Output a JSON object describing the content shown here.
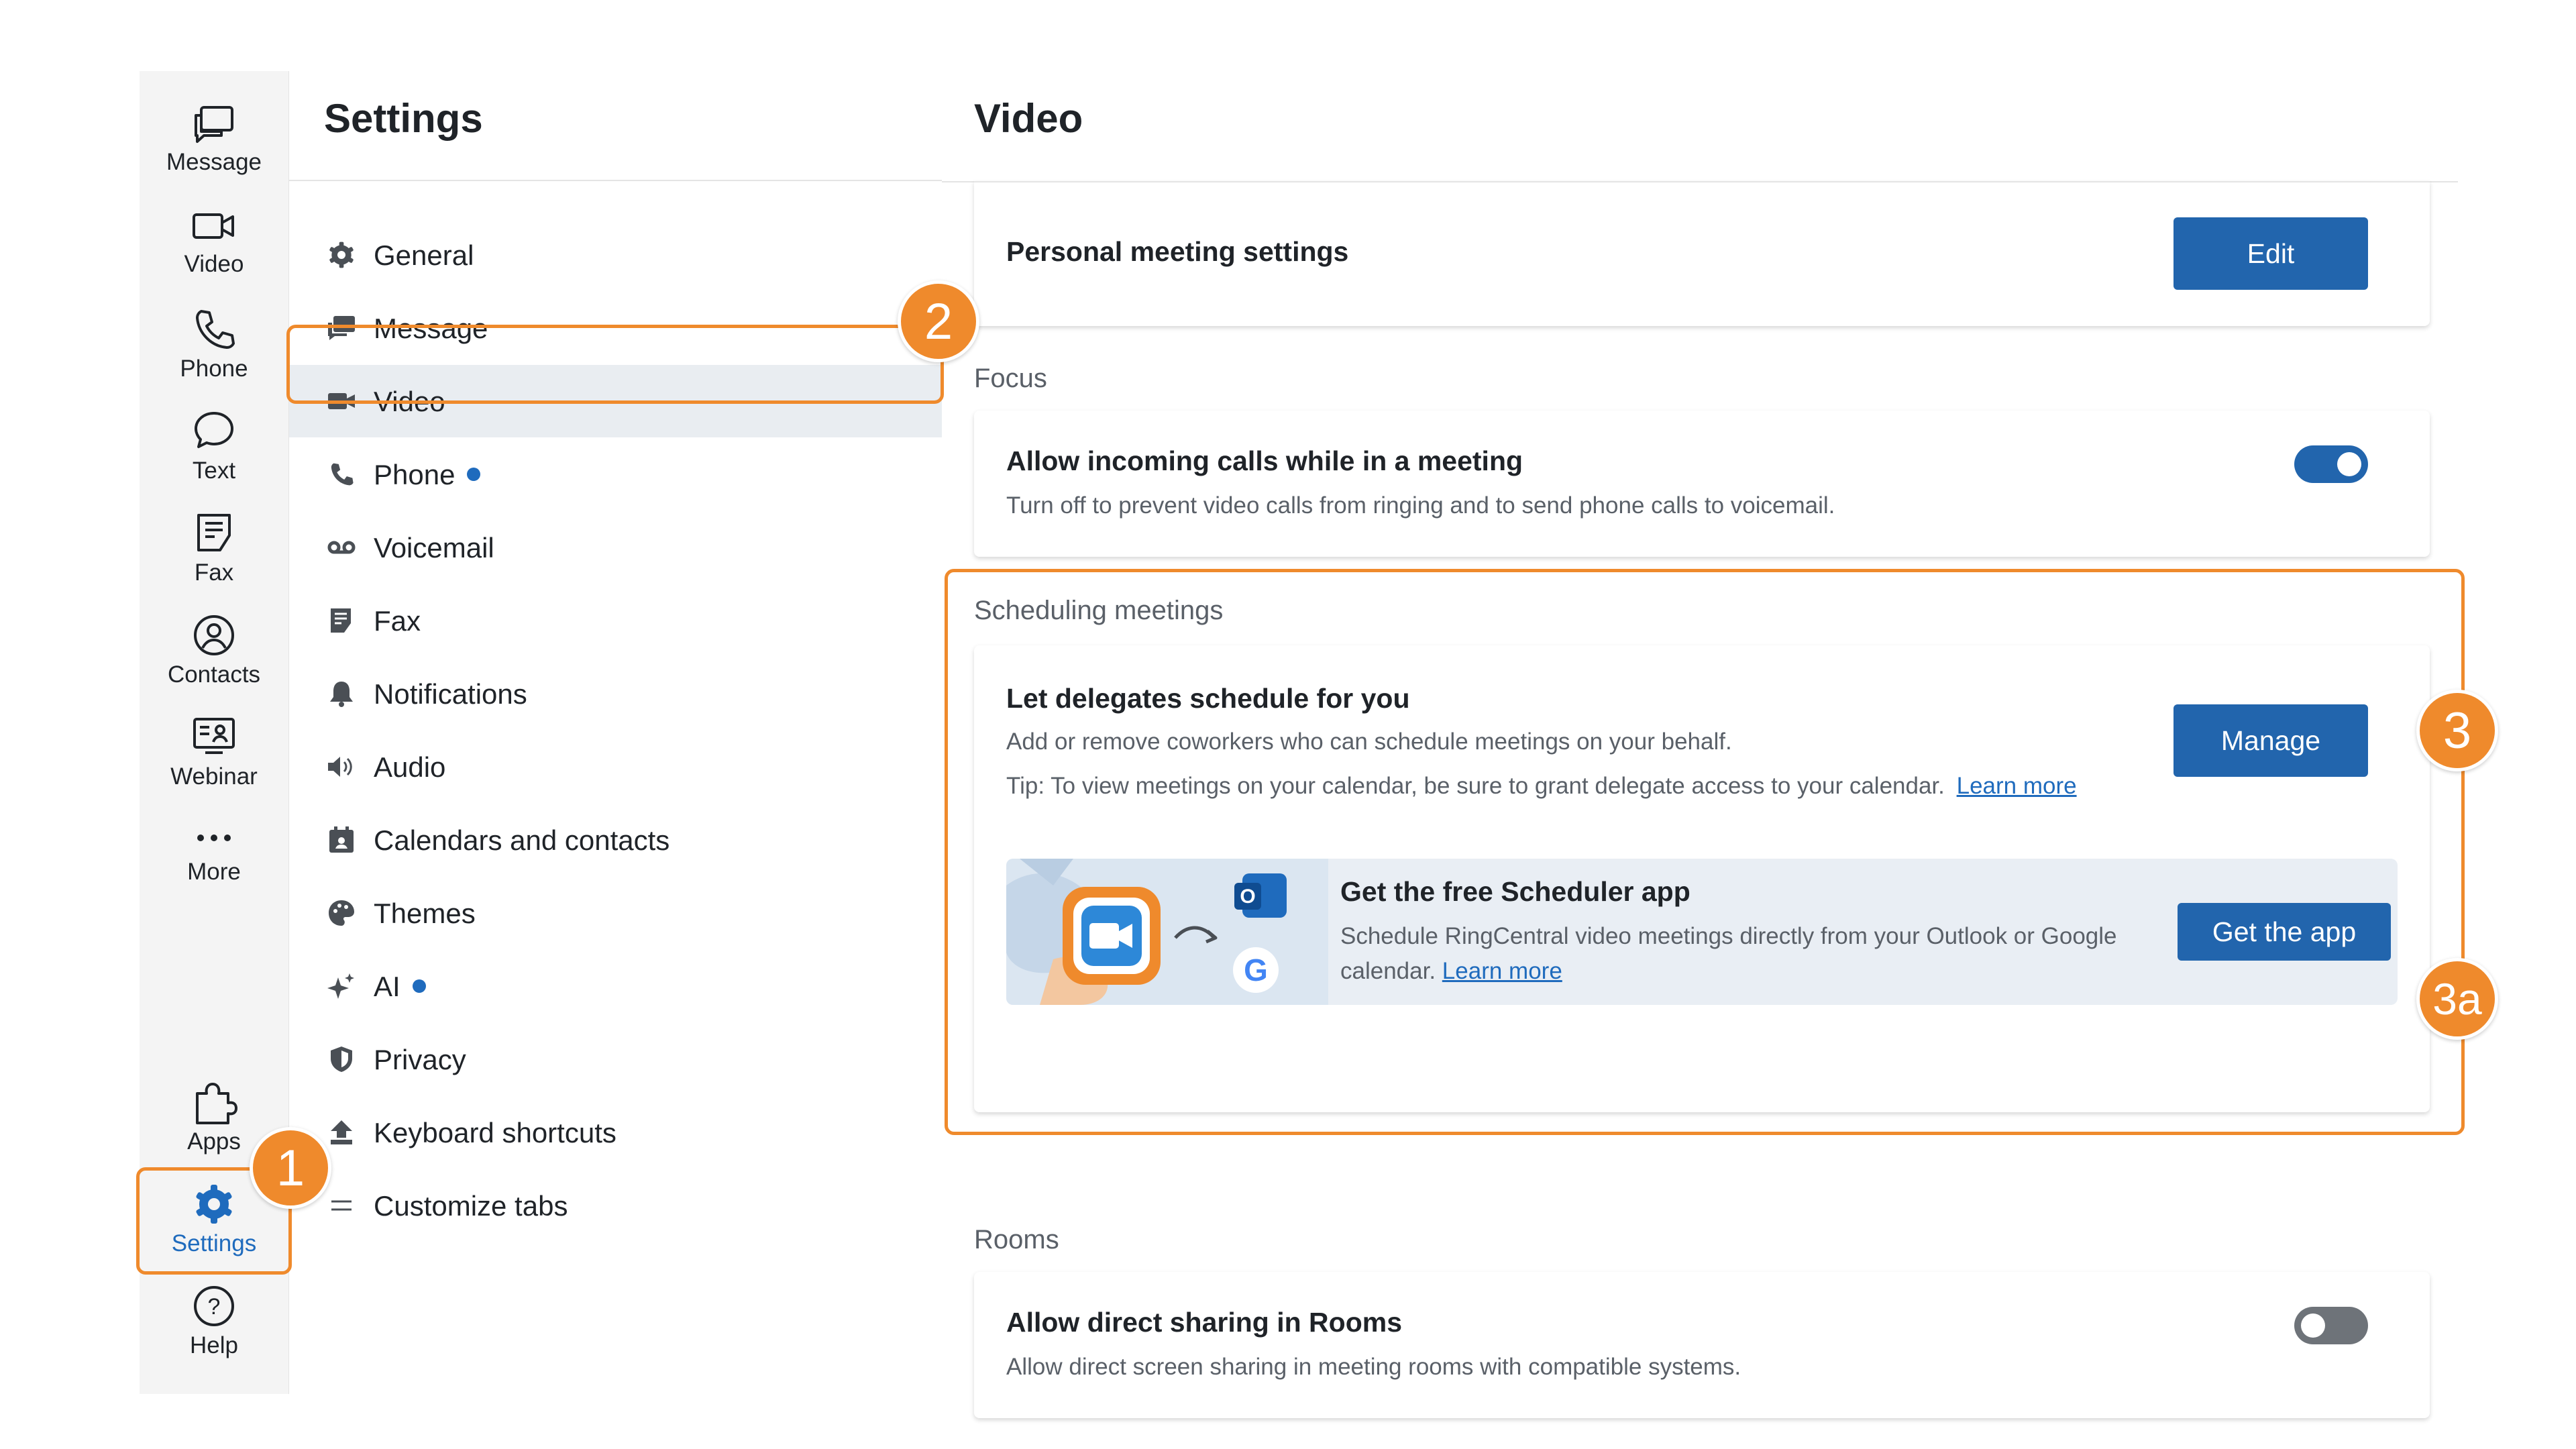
{
  "rail": {
    "items": [
      {
        "label": "Message",
        "icon": "message-icon"
      },
      {
        "label": "Video",
        "icon": "video-icon"
      },
      {
        "label": "Phone",
        "icon": "phone-icon"
      },
      {
        "label": "Text",
        "icon": "text-bubble-icon"
      },
      {
        "label": "Fax",
        "icon": "fax-icon"
      },
      {
        "label": "Contacts",
        "icon": "contacts-icon"
      },
      {
        "label": "Webinar",
        "icon": "webinar-icon"
      },
      {
        "label": "More",
        "icon": "more-dots-icon"
      }
    ],
    "bottom": [
      {
        "label": "Apps",
        "icon": "puzzle-icon"
      },
      {
        "label": "Settings",
        "icon": "gear-icon",
        "active": true
      },
      {
        "label": "Help",
        "icon": "help-icon"
      }
    ]
  },
  "nav": {
    "title": "Settings",
    "items": [
      {
        "label": "General",
        "icon": "gear-icon"
      },
      {
        "label": "Message",
        "icon": "message-icon"
      },
      {
        "label": "Video",
        "icon": "video-camera-icon",
        "active": true
      },
      {
        "label": "Phone",
        "icon": "phone-icon",
        "dot": true
      },
      {
        "label": "Voicemail",
        "icon": "voicemail-icon"
      },
      {
        "label": "Fax",
        "icon": "fax-icon"
      },
      {
        "label": "Notifications",
        "icon": "bell-icon"
      },
      {
        "label": "Audio",
        "icon": "speaker-icon"
      },
      {
        "label": "Calendars and contacts",
        "icon": "calendar-icon"
      },
      {
        "label": "Themes",
        "icon": "palette-icon"
      },
      {
        "label": "AI",
        "icon": "sparkle-icon",
        "dot": true
      },
      {
        "label": "Privacy",
        "icon": "shield-icon"
      },
      {
        "label": "Keyboard shortcuts",
        "icon": "keyboard-upload-icon"
      },
      {
        "label": "Customize tabs",
        "icon": "list-icon"
      }
    ]
  },
  "main": {
    "title": "Video",
    "personal": {
      "title": "Personal meeting settings",
      "button": "Edit"
    },
    "focus": {
      "section": "Focus",
      "title": "Allow incoming calls while in a meeting",
      "desc": "Turn off to prevent video calls from ringing and to send phone calls to voicemail.",
      "toggle_on": true
    },
    "scheduling": {
      "section": "Scheduling meetings",
      "title": "Let delegates schedule for you",
      "desc": "Add or remove coworkers who can schedule meetings on your behalf.",
      "tip": "Tip: To view meetings on your calendar, be sure to grant delegate access to your calendar.",
      "tip_link": "Learn more",
      "button": "Manage",
      "app": {
        "title": "Get the free Scheduler app",
        "desc_line1": "Schedule RingCentral video meetings directly from your Outlook or Google",
        "desc_line2": "calendar.",
        "link": "Learn more",
        "button": "Get the app"
      }
    },
    "rooms": {
      "section": "Rooms",
      "title": "Allow direct sharing in Rooms",
      "desc": "Allow direct screen sharing in meeting rooms with compatible systems.",
      "toggle_on": false
    }
  },
  "annotations": {
    "b1": "1",
    "b2": "2",
    "b3": "3",
    "b3a": "3a"
  },
  "colors": {
    "accent": "#2265ad",
    "annotation": "#ef8a2c",
    "active_nav": "#e9edf1",
    "toggle_off": "#6e7379"
  }
}
